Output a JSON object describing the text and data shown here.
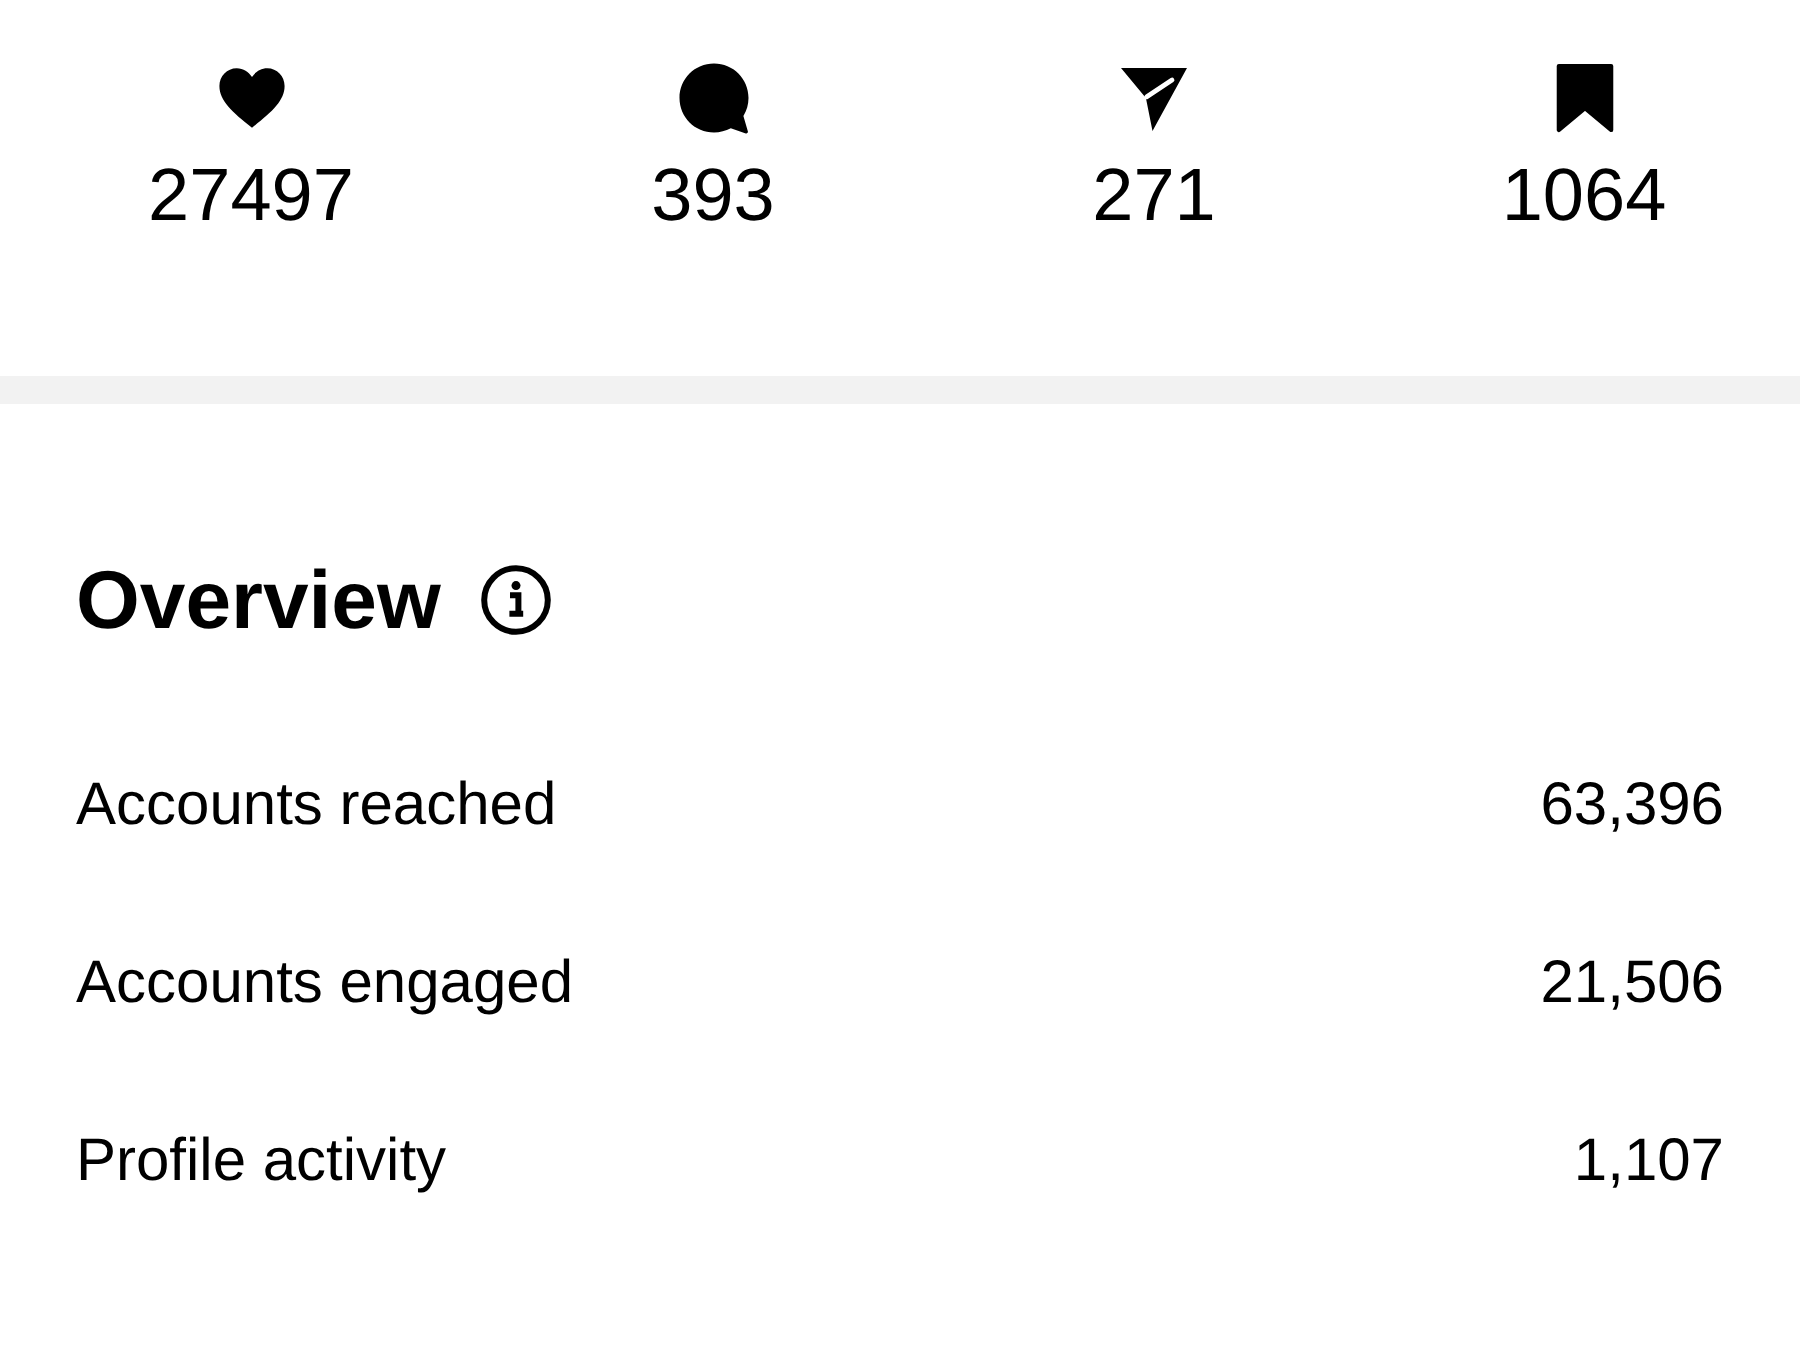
{
  "stats": [
    {
      "kind": "likes",
      "count": "27497"
    },
    {
      "kind": "comments",
      "count": "393"
    },
    {
      "kind": "shares",
      "count": "271"
    },
    {
      "kind": "saves",
      "count": "1064"
    }
  ],
  "overview": {
    "title": "Overview",
    "rows": [
      {
        "label": "Accounts reached",
        "value": "63,396"
      },
      {
        "label": "Accounts engaged",
        "value": "21,506"
      },
      {
        "label": "Profile activity",
        "value": "1,107"
      }
    ]
  }
}
